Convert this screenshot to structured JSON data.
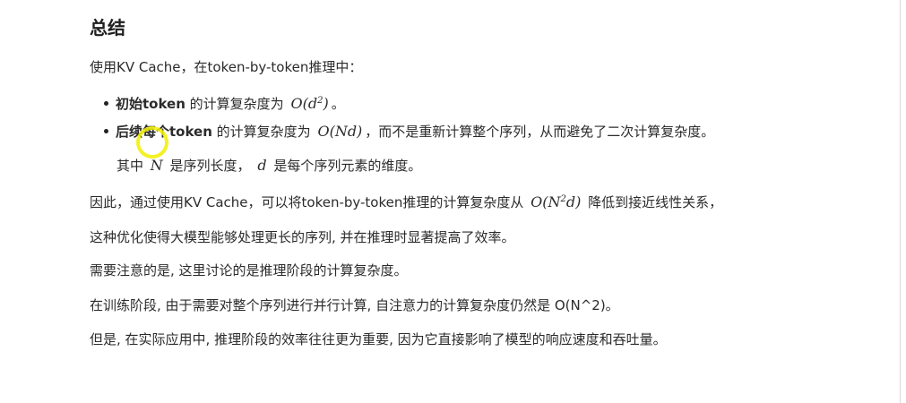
{
  "heading": "总结",
  "intro": "使用KV Cache，在token-by-token推理中：",
  "bullet1": {
    "bold": "初始token",
    "text": " 的计算复杂度为 ",
    "math_base": "O(d",
    "math_sup": "2",
    "math_end": ")",
    "tail": "。"
  },
  "bullet2": {
    "bold": "后续每个token",
    "text": " 的计算复杂度为 ",
    "math": "O(Nd)",
    "tail": "，而不是重新计算整个序列，从而避免了二次计算复杂度。"
  },
  "note": {
    "prefix": "其中 ",
    "var1": "N",
    "mid": " 是序列长度， ",
    "var2": "d",
    "suffix": " 是每个序列元素的维度。"
  },
  "conclusion": {
    "prefix": "因此，通过使用KV Cache，可以将token-by-token推理的计算复杂度从 ",
    "math_base": "O(N",
    "math_sup": "2",
    "math_end": "d)",
    "suffix": " 降低到接近线性关系，"
  },
  "para2": "这种优化使得大模型能够处理更长的序列, 并在推理时显著提高了效率。",
  "para3": "需要注意的是, 这里讨论的是推理阶段的计算复杂度。",
  "para4": "在训练阶段, 由于需要对整个序列进行并行计算, 自注意力的计算复杂度仍然是 O(N^2)。",
  "para5": "但是, 在实际应用中, 推理阶段的效率往往更为重要, 因为它直接影响了模型的响应速度和吞吐量。",
  "colors": {
    "text": "#2b2b2b",
    "cursor_highlight": "#f2ee00"
  }
}
